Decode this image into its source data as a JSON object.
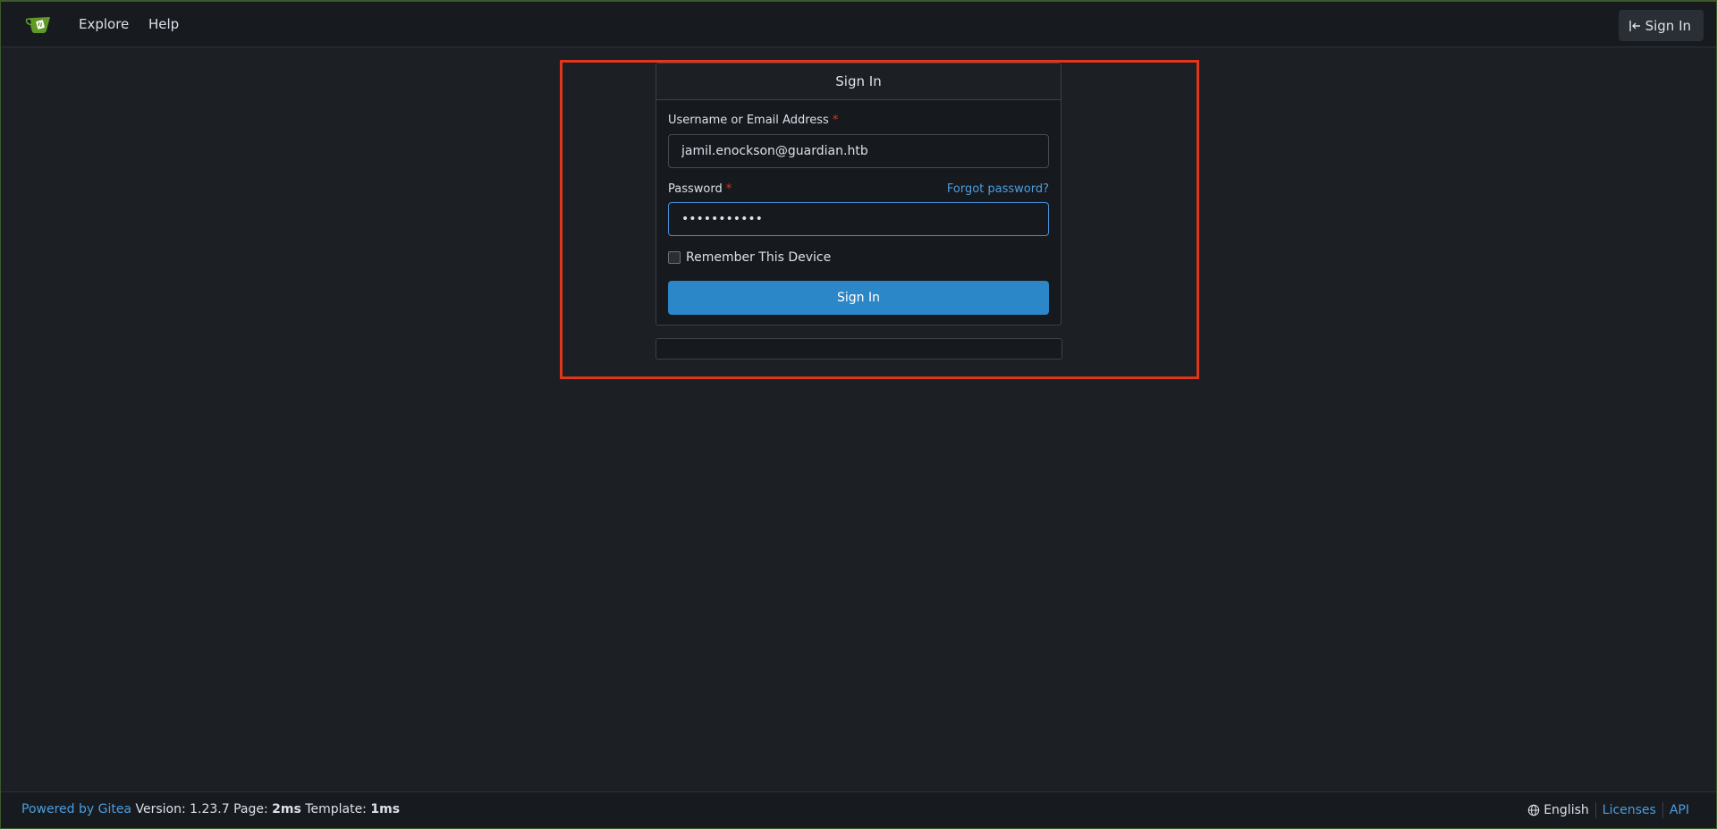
{
  "navbar": {
    "explore": "Explore",
    "help": "Help",
    "signin": "Sign In"
  },
  "form": {
    "title": "Sign In",
    "username_label": "Username or Email Address",
    "username_value": "jamil.enockson@guardian.htb",
    "password_label": "Password",
    "password_value": "•••••••••••",
    "required_mark": "*",
    "forgot": "Forgot password?",
    "remember": "Remember This Device",
    "submit": "Sign In"
  },
  "footer": {
    "powered": "Powered by Gitea",
    "version_text": "Version: 1.23.7 Page:",
    "page_time": "2ms",
    "template_text": "Template:",
    "template_time": "1ms",
    "language": "English",
    "licenses": "Licenses",
    "api": "API"
  },
  "colors": {
    "accent": "#2c87c8",
    "link": "#4a9ee0",
    "highlight": "#e0361c",
    "logo": "#609926"
  }
}
